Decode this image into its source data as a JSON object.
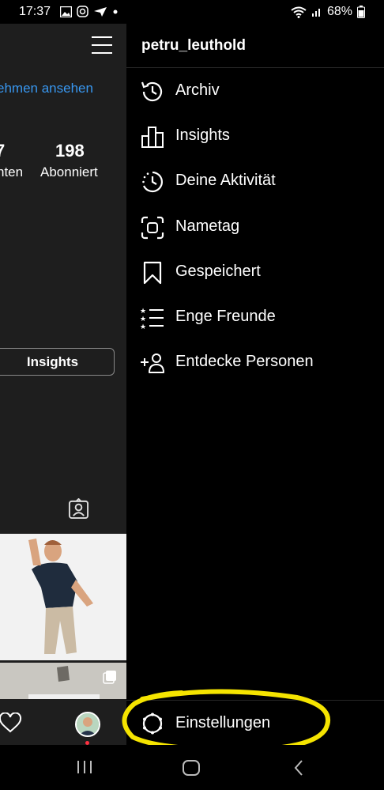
{
  "status_bar": {
    "time": "17:37",
    "battery": "68%"
  },
  "profile": {
    "link_text": "ehmen ansehen",
    "stat_left_num": "7",
    "stat_left_label": "nten",
    "following_count": "198",
    "following_label": "Abonniert",
    "insights_button": "Insights"
  },
  "drawer": {
    "username": "petru_leuthold",
    "items": [
      {
        "label": "Archiv",
        "icon": "archive-icon"
      },
      {
        "label": "Insights",
        "icon": "insights-icon"
      },
      {
        "label": "Deine Aktivität",
        "icon": "activity-icon"
      },
      {
        "label": "Nametag",
        "icon": "nametag-icon"
      },
      {
        "label": "Gespeichert",
        "icon": "bookmark-icon"
      },
      {
        "label": "Enge Freunde",
        "icon": "close-friends-icon"
      },
      {
        "label": "Entdecke Personen",
        "icon": "add-person-icon"
      }
    ],
    "settings_label": "Einstellungen"
  },
  "colors": {
    "accent_link": "#3897f0",
    "highlight": "#f5e400",
    "left_panel_bg": "#1e1e1e"
  }
}
